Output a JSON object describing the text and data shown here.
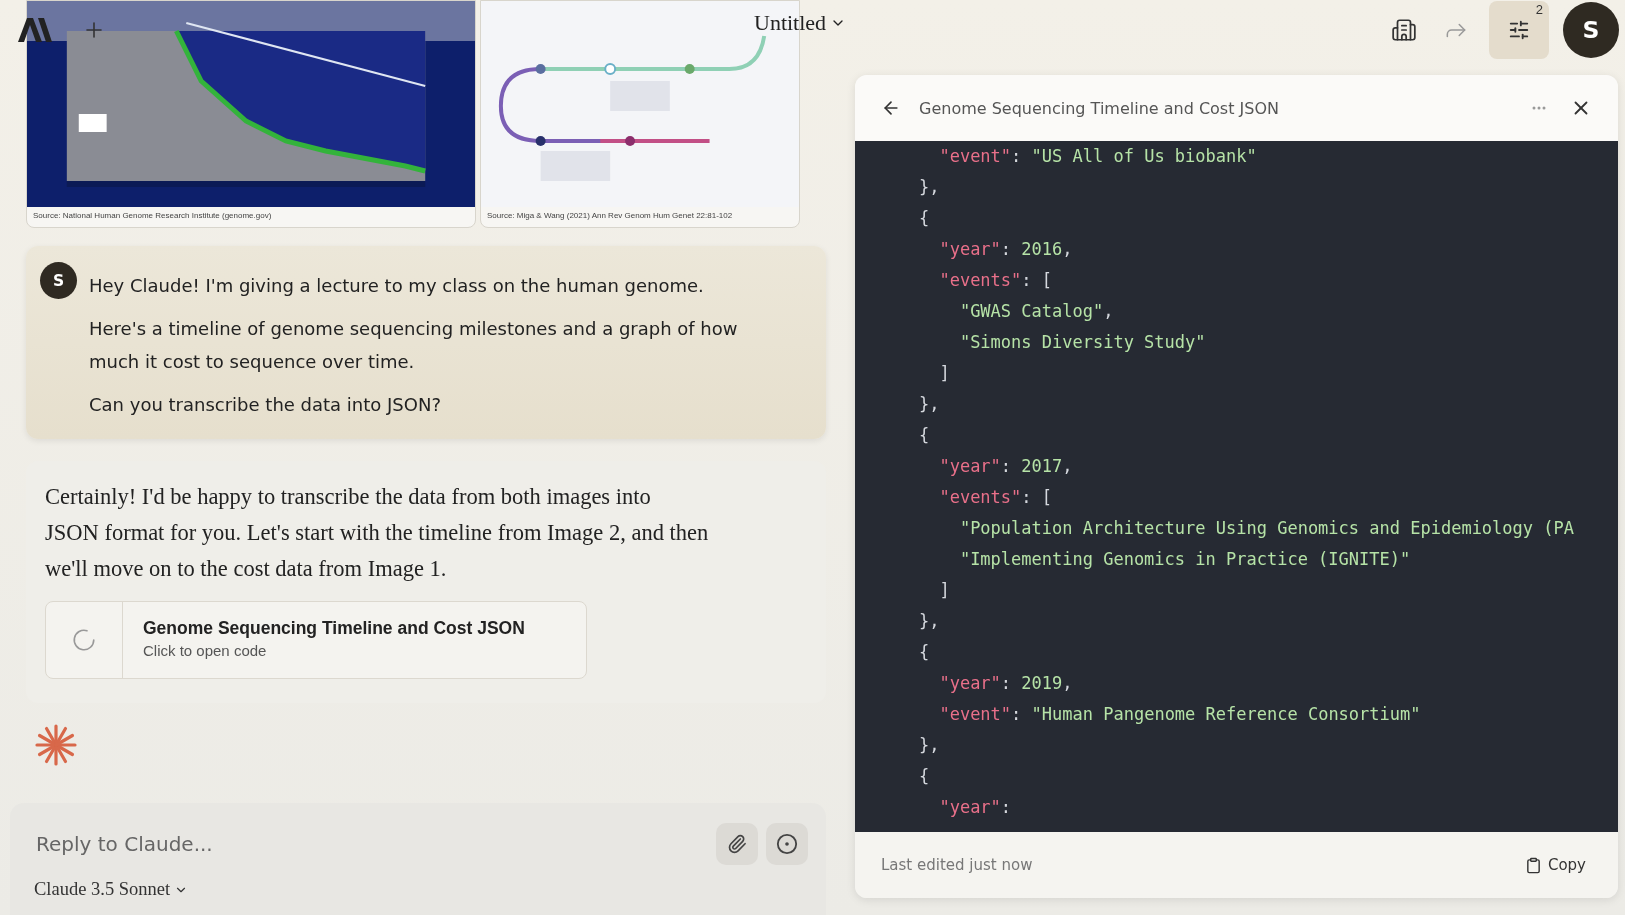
{
  "top_bar": {
    "title": "Untitled",
    "settings_badge": "2",
    "avatar_initial": "S"
  },
  "attachments": [
    {
      "kind": "picture",
      "caption": "Source: National Human Genome Research Institute (genome.gov)"
    },
    {
      "kind": "picture",
      "caption": "Source: Miga & Wang (2021) Ann Rev Genom Hum Genet 22:81-102"
    }
  ],
  "user_message": {
    "avatar_initial": "S",
    "paragraphs": [
      "Hey Claude! I'm giving a lecture to my class on the human genome.",
      "Here's a timeline of genome sequencing milestones and a graph of how much it cost to sequence over time.",
      "Can you transcribe the data into JSON?"
    ]
  },
  "assistant_message": {
    "text": "Certainly! I'd be happy to transcribe the data from both images into JSON format for you. Let's start with the timeline from Image 2, and then we'll move on to the cost data from Image 1.",
    "artifact": {
      "title": "Genome Sequencing Timeline and Cost JSON",
      "subtitle": "Click to open code"
    }
  },
  "composer": {
    "placeholder": "Reply to Claude...",
    "model": "Claude 3.5 Sonnet"
  },
  "artifact_panel": {
    "title": "Genome Sequencing Timeline and Cost JSON",
    "code_lines": [
      "      \"event\": \"US All of Us biobank\"",
      "    },",
      "    {",
      "      \"year\": 2016,",
      "      \"events\": [",
      "        \"GWAS Catalog\",",
      "        \"Simons Diversity Study\"",
      "      ]",
      "    },",
      "    {",
      "      \"year\": 2017,",
      "      \"events\": [",
      "        \"Population Architecture Using Genomics and Epidemiology (PA",
      "        \"Implementing Genomics in Practice (IGNITE)\"",
      "      ]",
      "    },",
      "    {",
      "      \"year\": 2019,",
      "      \"event\": \"Human Pangenome Reference Consortium\"",
      "    },",
      "    {",
      "      \"year\":"
    ],
    "status": "Last edited just now",
    "copy_label": "Copy"
  }
}
